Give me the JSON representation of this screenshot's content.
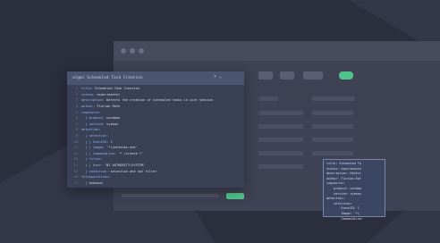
{
  "editor": {
    "title": "algmi Scheduled Task Creation",
    "controls": "× ⌄",
    "lines": [
      {
        "n": "1",
        "k": "title:",
        "v": " Scheduled Task Creation"
      },
      {
        "n": "2",
        "k": "status:",
        "v": " experimental"
      },
      {
        "n": "3",
        "k": "description:",
        "v": " Detects the creation of scheduled tasks in user session"
      },
      {
        "n": "4",
        "k": "author:",
        "v": " Florian Roth"
      },
      {
        "n": "5",
        "k": "logsource:",
        "v": ""
      },
      {
        "n": "6",
        "k": "  | product:",
        "v": " windows"
      },
      {
        "n": "7",
        "k": "  | service:",
        "v": " sysmon"
      },
      {
        "n": "8",
        "k": "detection:",
        "v": ""
      },
      {
        "n": "9",
        "k": "  | selection:",
        "v": ""
      },
      {
        "n": "10",
        "k": "  | | EventID:",
        "v": " 1"
      },
      {
        "n": "11",
        "k": "  | | Image:",
        "v": " '*\\schtasks.exe'"
      },
      {
        "n": "12",
        "k": "  | | CommandLine:",
        "v": " '* /create *'"
      },
      {
        "n": "13",
        "k": "  | filter:",
        "v": ""
      },
      {
        "n": "14",
        "k": "  | | User:",
        "v": " 'NT AUTHORITY\\SYSTEM'"
      },
      {
        "n": "15",
        "k": "  | condition:",
        "v": " selection and not filter"
      },
      {
        "n": "16",
        "k": "falsepositives:",
        "v": ""
      },
      {
        "n": "17",
        "k": "  | ",
        "v": "Unknown"
      }
    ]
  },
  "tooltip": {
    "lines": [
      "title: Scheduled Ta",
      "status: experimenta",
      "description: Detect",
      "author: Florian Rot",
      "logsource:",
      "    product: window",
      "    service: sysmon",
      "detection:",
      "    selection:",
      "        EventID: 1",
      "        Image: '*\\",
      "        CommandLine:"
    ]
  },
  "colors": {
    "accent": "#4fc38a",
    "background": "#2b2e3c",
    "window": "#3f4254",
    "editor": "#3a4156"
  }
}
